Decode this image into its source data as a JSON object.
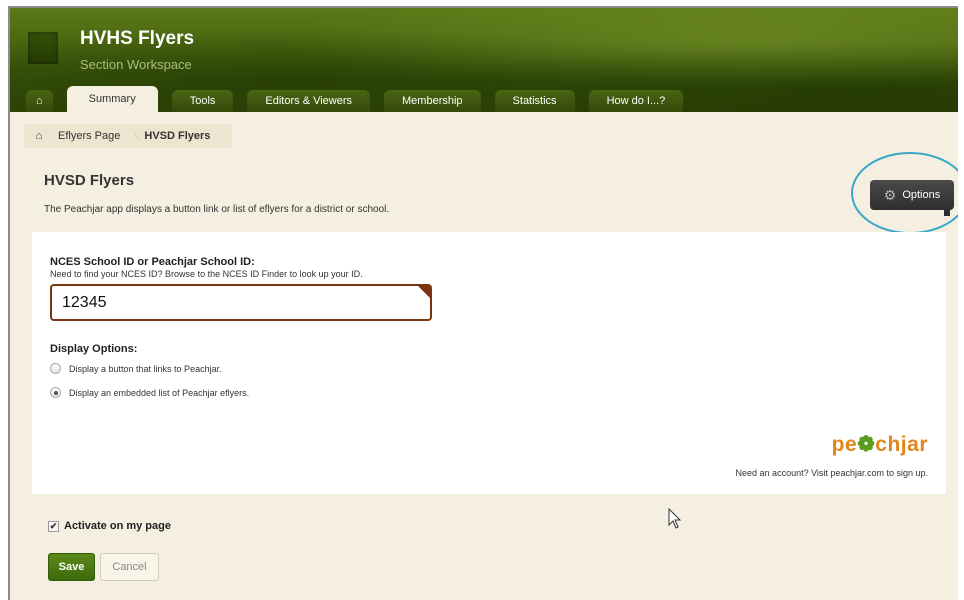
{
  "header": {
    "site_title": "HVHS Flyers",
    "site_subtitle": "Section Workspace"
  },
  "tabs": [
    {
      "label": "",
      "icon": "home-icon"
    },
    {
      "label": "Summary",
      "active": true
    },
    {
      "label": "Tools"
    },
    {
      "label": "Editors & Viewers"
    },
    {
      "label": "Membership"
    },
    {
      "label": "Statistics"
    },
    {
      "label": "How do I...?"
    }
  ],
  "breadcrumb": {
    "home_icon": "home-icon",
    "items": [
      "Eflyers Page",
      "HVSD Flyers"
    ]
  },
  "panel": {
    "title": "HVSD Flyers",
    "description": "The Peachjar app displays a button link or list of eflyers for a district or school.",
    "options_label": "Options"
  },
  "form": {
    "field_label": "NCES School ID or Peachjar School ID:",
    "field_help": "Need to find your NCES ID? Browse to the NCES ID Finder to look up your ID.",
    "school_id_value": "12345",
    "display_options_label": "Display Options:",
    "display_options": [
      {
        "label": "Display a button that links to Peachjar.",
        "selected": false
      },
      {
        "label": "Display an embedded list of Peachjar eflyers.",
        "selected": true
      }
    ]
  },
  "branding": {
    "logo_text_pre": "pe",
    "logo_text_post": "chjar",
    "signup_text": "Need an account? Visit peachjar.com to sign up."
  },
  "footer": {
    "activate_label": "Activate on my page",
    "activate_checked": true,
    "save_label": "Save",
    "cancel_label": "Cancel"
  },
  "colors": {
    "header_green": "#3f5a0b",
    "save_green": "#4a7a12",
    "input_border": "#7a3410",
    "highlight_circle": "#3aa7c9",
    "peachjar_orange": "#e2861b"
  }
}
